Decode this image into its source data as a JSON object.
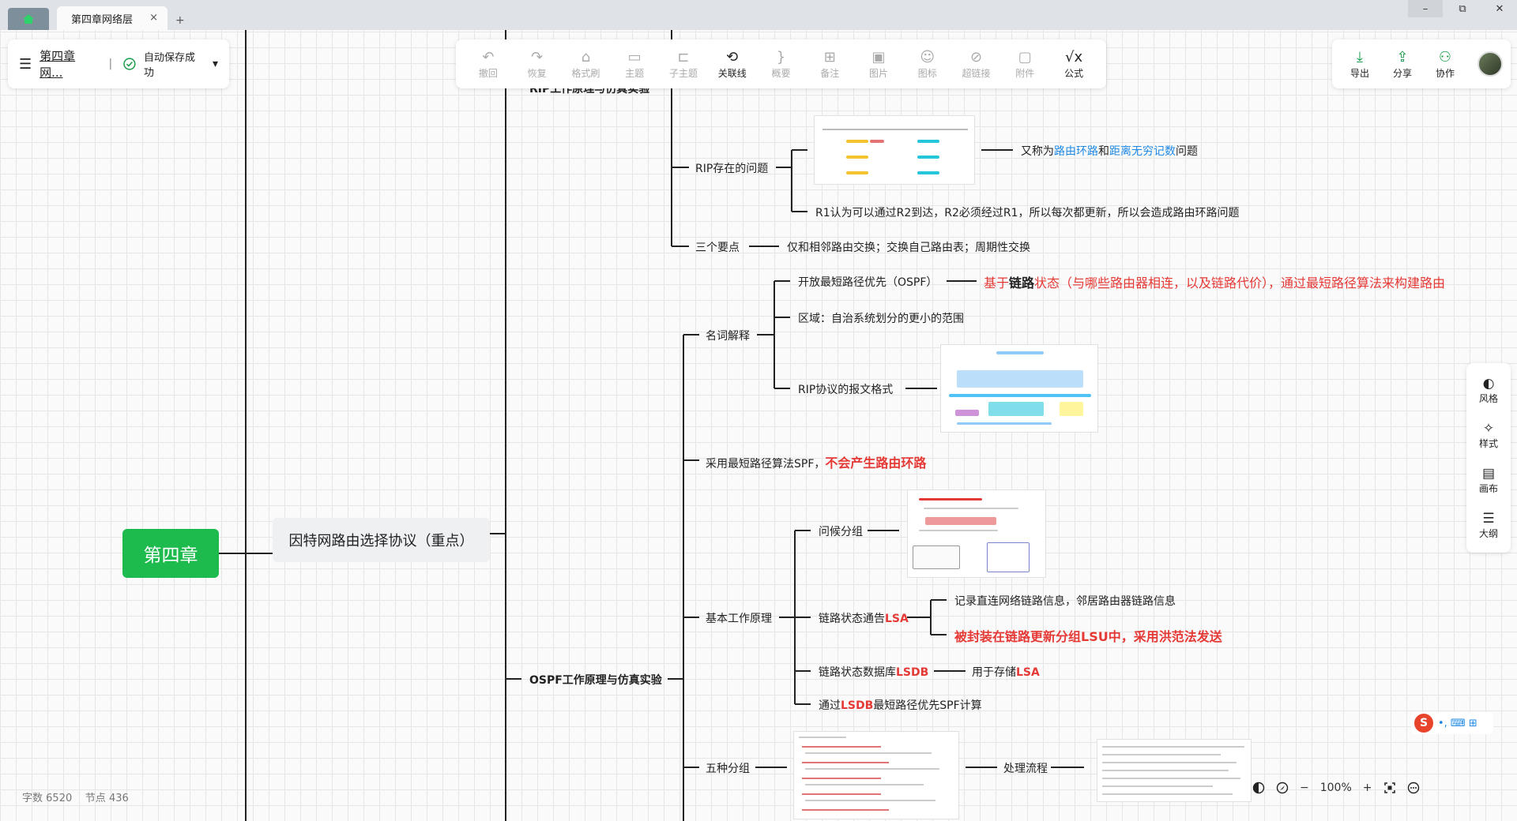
{
  "tabs": {
    "home_icon": "home-icon",
    "doc_tab_label": "第四章网络层",
    "close_glyph": "×",
    "new_tab_glyph": "+"
  },
  "window": {
    "minimize": "–",
    "maximize": "⧉",
    "close": "✕"
  },
  "doc_card": {
    "menu_glyph": "☰",
    "title": "第四章网...",
    "separator": "|",
    "save_status": "自动保存成功",
    "dropdown_glyph": "▾"
  },
  "toolbar": {
    "items": [
      {
        "label": "撤回",
        "icon": "↶"
      },
      {
        "label": "恢复",
        "icon": "↷"
      },
      {
        "label": "格式刷",
        "icon": "⌂"
      },
      {
        "label": "主题",
        "icon": "▭"
      },
      {
        "label": "子主题",
        "icon": "⊏"
      },
      {
        "label": "关联线",
        "icon": "⟲"
      },
      {
        "label": "概要",
        "icon": "}"
      },
      {
        "label": "备注",
        "icon": "⊞"
      },
      {
        "label": "图片",
        "icon": "▣"
      },
      {
        "label": "图标",
        "icon": "☺"
      },
      {
        "label": "超链接",
        "icon": "⊘"
      },
      {
        "label": "附件",
        "icon": "▢"
      },
      {
        "label": "公式",
        "icon": "√x"
      }
    ],
    "right": [
      {
        "label": "导出",
        "icon": "⤓"
      },
      {
        "label": "分享",
        "icon": "⇪"
      },
      {
        "label": "协作",
        "icon": "⚇"
      }
    ]
  },
  "side_panel": [
    {
      "label": "风格",
      "icon": "◐"
    },
    {
      "label": "样式",
      "icon": "✧"
    },
    {
      "label": "画布",
      "icon": "▤"
    },
    {
      "label": "大纲",
      "icon": "☰"
    }
  ],
  "mindmap": {
    "root": "第四章",
    "l1": "因特网路由选择协议（重点）",
    "rip_top_cut": "RIP工作原理与仿真实验",
    "rip_problem": "RIP存在的问题",
    "rip_also_called_1": "又称为",
    "rip_also_called_2": "路由环路",
    "rip_also_called_3": "和",
    "rip_also_called_4": "距离无穷记数",
    "rip_also_called_5": "问题",
    "rip_r1": "R1认为可以通过R2到达，R2必须经过R1，所以每次都更新，所以会造成路由环路问题",
    "three_points": "三个要点",
    "three_points_detail": "仅和相邻路由交换；交换自己路由表；周期性交换",
    "ospf": "OSPF工作原理与仿真实验",
    "terms": "名词解释",
    "ospf_open": "开放最短路径优先（OSPF）",
    "ospf_def_1": "基于",
    "ospf_def_2": "链路",
    "ospf_def_3": "状态（与哪些路由器相连，以及链路代价），通过最短路径算法来构建路由",
    "area": "区域：自治系统划分的更小的范围",
    "rip_packet": "RIP协议的报文格式",
    "spf_1": "采用最短路径算法SPF，",
    "spf_2": "不会产生路由环路",
    "basic": "基本工作原理",
    "hello": "问候分组",
    "lsa_1": "链路状态通告",
    "lsa_2": "LSA",
    "lsa_detail1": "记录直连网络链路信息，邻居路由器链路信息",
    "lsa_detail2": "被封装在链路更新分组LSU中，采用洪范法发送",
    "lsdb_1": "链路状态数据库",
    "lsdb_2": "LSDB",
    "lsdb_detail_1": "用于存储",
    "lsdb_detail_2": "LSA",
    "spf_calc_1": "通过",
    "spf_calc_2": "LSDB",
    "spf_calc_3": "最短路径优先SPF计算",
    "five": "五种分组",
    "process": "处理流程"
  },
  "status": {
    "word_label": "字数",
    "word_count": "6520",
    "node_label": "节点",
    "node_count": "436"
  },
  "zoom": {
    "level": "100%",
    "minus": "−",
    "plus": "+"
  },
  "ime": {
    "logo": "S",
    "glyphs": "•, ⌨ ⊞"
  }
}
